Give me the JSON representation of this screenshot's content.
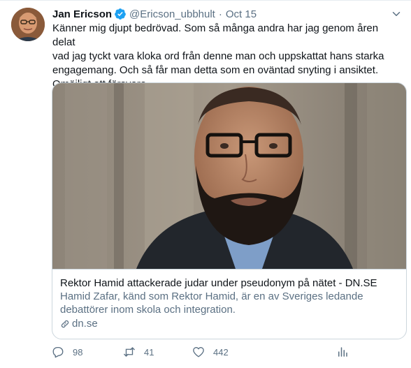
{
  "tweet": {
    "author_name": "Jan Ericson",
    "handle": "@Ericson_ubbhult",
    "separator": "·",
    "date": "Oct 15",
    "lines": [
      "Känner mig djupt bedrövad. Som så många andra har jag genom åren delat",
      "vad jag tyckt vara kloka ord från denne man och uppskattat hans starka",
      "engagemang. Och så får man detta som en oväntad snyting i ansiktet.",
      "Omöjligt att försvara."
    ]
  },
  "card": {
    "title": "Rektor Hamid attackerade judar under pseudonym på nätet - DN.SE",
    "description_lines": [
      "Hamid Zafar, känd som Rektor Hamid, är en av Sveriges ledande",
      "debattörer inom skola och integration."
    ],
    "domain": "dn.se"
  },
  "actions": {
    "reply_count": "98",
    "retweet_count": "41",
    "like_count": "442"
  },
  "icons": {
    "verified": "verified-badge-icon",
    "caret": "chevron-down-icon",
    "link": "link-icon",
    "reply": "reply-icon",
    "retweet": "retweet-icon",
    "like": "heart-icon",
    "analytics": "analytics-icon"
  },
  "colors": {
    "accent": "#1da1f2",
    "muted": "#5b7083",
    "text": "#0f1419",
    "border": "#ccd6dd"
  }
}
